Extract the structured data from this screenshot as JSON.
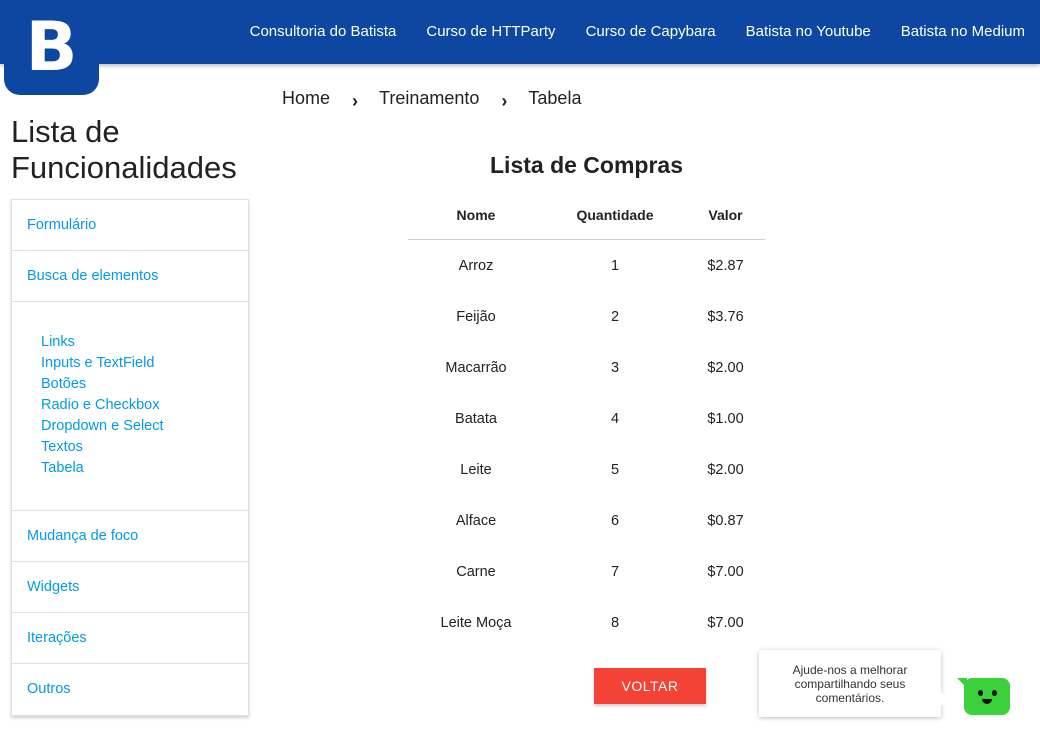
{
  "logo": {
    "letter": "B"
  },
  "nav": {
    "links": [
      "Consultoria do Batista",
      "Curso de HTTParty",
      "Curso de Capybara",
      "Batista no Youtube",
      "Batista no Medium"
    ]
  },
  "sidebar": {
    "title_line1": "Lista de",
    "title_line2": "Funcionalidades",
    "items": {
      "formulario": "Formulário",
      "busca": "Busca de elementos",
      "mudanca_foco": "Mudança de foco",
      "widgets": "Widgets",
      "iteracoes": "Iterações",
      "outros": "Outros"
    },
    "sub_items": [
      "Links",
      "Inputs e TextField",
      "Botões",
      "Radio e Checkbox",
      "Dropdown e Select",
      "Textos",
      "Tabela"
    ]
  },
  "breadcrumb": {
    "items": [
      "Home",
      "Treinamento",
      "Tabela"
    ],
    "separator": "›"
  },
  "table": {
    "title": "Lista de Compras",
    "headers": [
      "Nome",
      "Quantidade",
      "Valor"
    ],
    "rows": [
      [
        "Arroz",
        "1",
        "$2.87"
      ],
      [
        "Feijão",
        "2",
        "$3.76"
      ],
      [
        "Macarrão",
        "3",
        "$2.00"
      ],
      [
        "Batata",
        "4",
        "$1.00"
      ],
      [
        "Leite",
        "5",
        "$2.00"
      ],
      [
        "Alface",
        "6",
        "$0.87"
      ],
      [
        "Carne",
        "7",
        "$7.00"
      ],
      [
        "Leite Moça",
        "8",
        "$7.00"
      ]
    ]
  },
  "buttons": {
    "back": "VOLTAR"
  },
  "feedback": {
    "text": "Ajude-nos a melhorar compartilhando seus comentários."
  },
  "colors": {
    "navbar": "#0d47a1",
    "link": "#039be5",
    "back_button": "#f44336",
    "chat_bot": "#3ad13a"
  }
}
